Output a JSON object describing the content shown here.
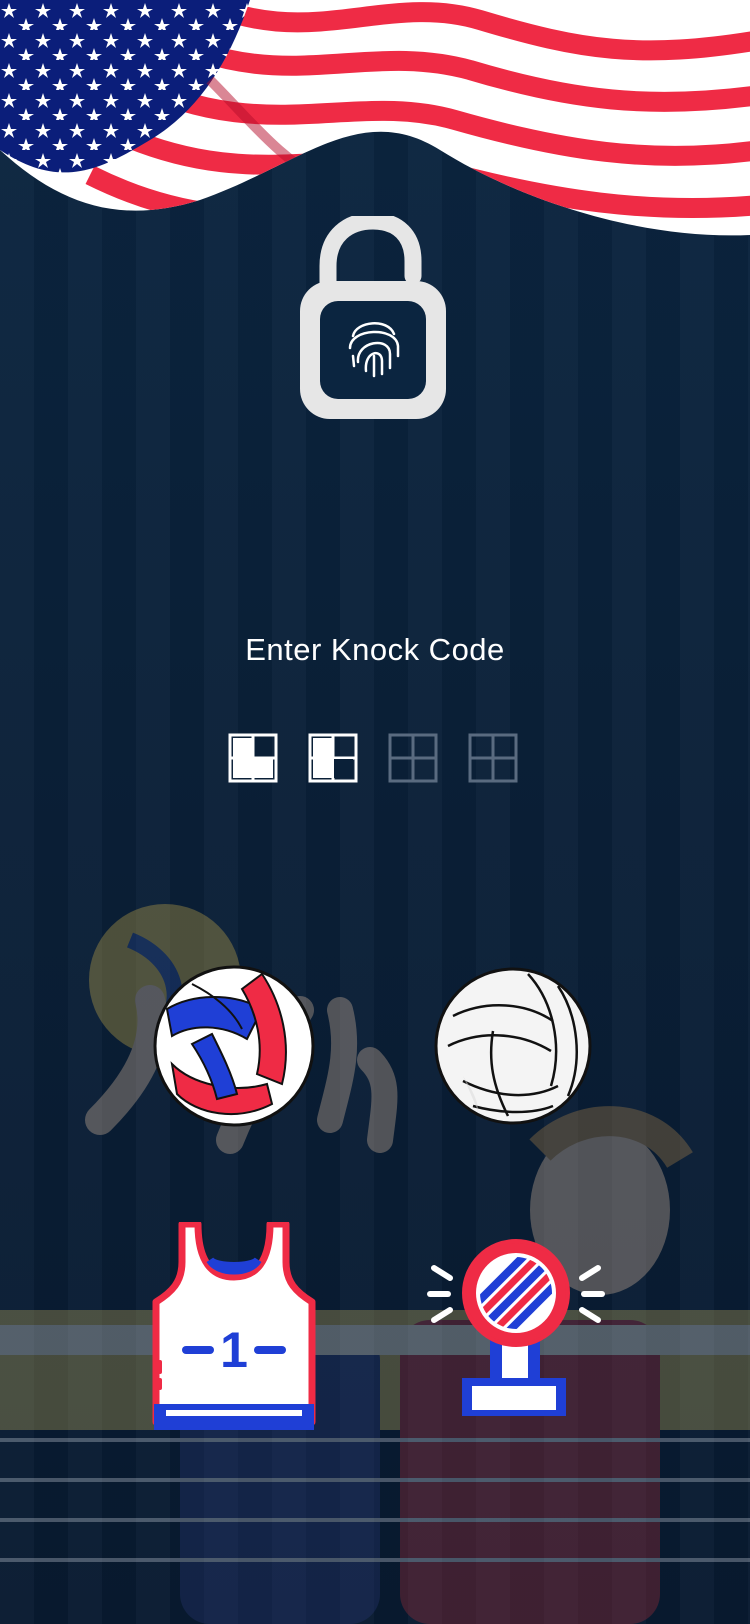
{
  "prompt": {
    "title": "Enter Knock Code"
  },
  "knock_code": {
    "length": 4,
    "entered": 2,
    "filled_quadrants": [
      [
        "bottom-left",
        "bottom-right",
        "top-left"
      ],
      [
        "top-left",
        "bottom-right",
        "bottom-left"
      ]
    ]
  },
  "keys": [
    {
      "name": "volleyball-colored-key",
      "icon": "red-white-blue-volleyball-icon"
    },
    {
      "name": "volleyball-white-key",
      "icon": "white-volleyball-icon"
    },
    {
      "name": "jersey-key",
      "icon": "jersey-icon"
    },
    {
      "name": "trophy-key",
      "icon": "volleyball-trophy-icon"
    }
  ],
  "colors": {
    "red": "#ef2b45",
    "blue": "#1f3fd6",
    "navy": "#0a2038",
    "white": "#ffffff"
  },
  "jersey": {
    "number": "1"
  }
}
